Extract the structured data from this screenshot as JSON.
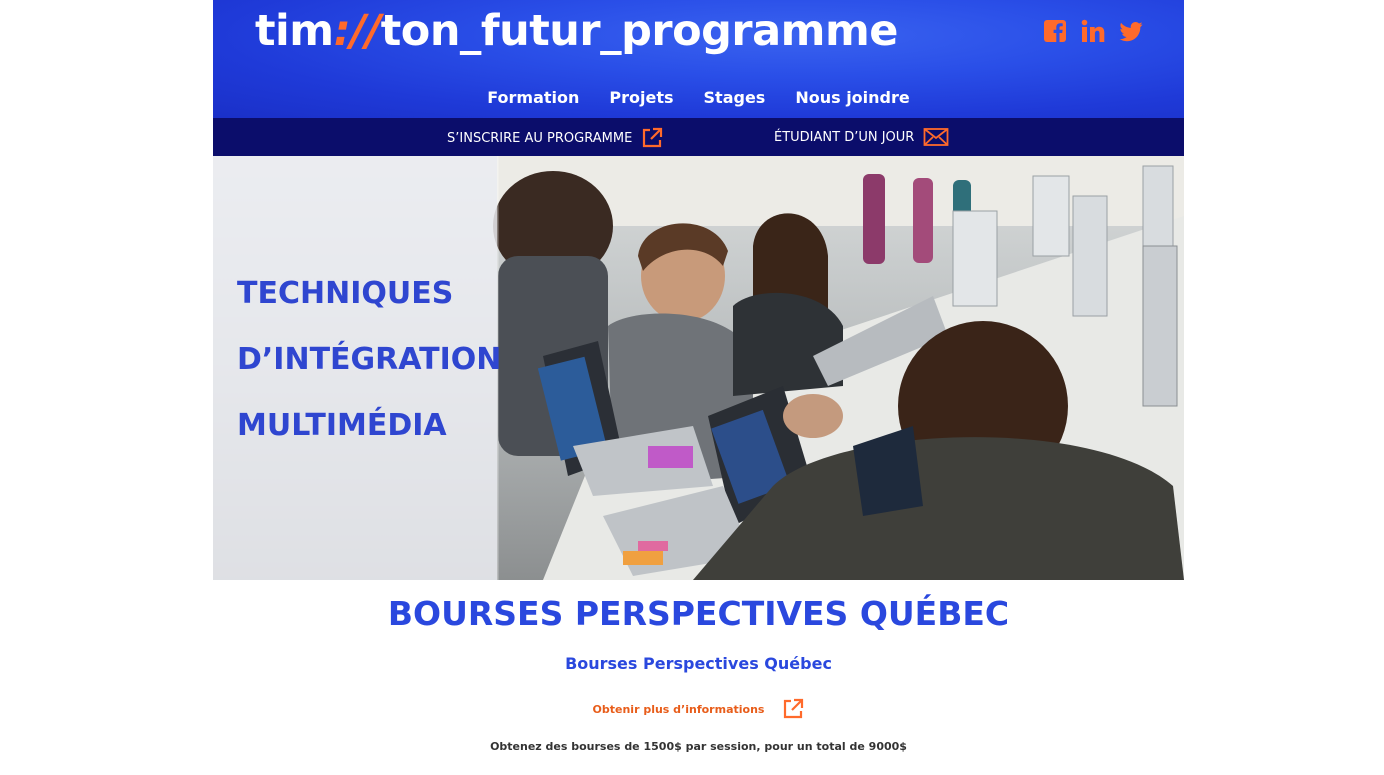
{
  "header": {
    "logo_prefix": "tim",
    "logo_separator": "://",
    "logo_suffix": "ton_futur_programme",
    "social": [
      "facebook-icon",
      "linkedin-icon",
      "twitter-icon"
    ]
  },
  "nav": [
    "Formation",
    "Projets",
    "Stages",
    "Nous joindre"
  ],
  "subbar": {
    "inscrire": "S’INSCRIRE AU PROGRAMME",
    "etudiant": "ÉTUDIANT D’UN JOUR"
  },
  "hero": {
    "title_lines": [
      "TECHNIQUES",
      "D’INTÉGRATION",
      "MULTIMÉDIA"
    ]
  },
  "main": {
    "heading": "BOURSES PERSPECTIVES QUÉBEC",
    "subheading": "Bourses Perspectives Québec",
    "info_link": "Obtenir plus d’informations",
    "description": "Obtenez des bourses de 1500$ par session, pour un total de 9000$"
  },
  "colors": {
    "header_blue": "#2a4fe8",
    "subbar_navy": "#0b0d6b",
    "accent_orange": "#ff6a2b",
    "title_blue": "#2a48de"
  }
}
